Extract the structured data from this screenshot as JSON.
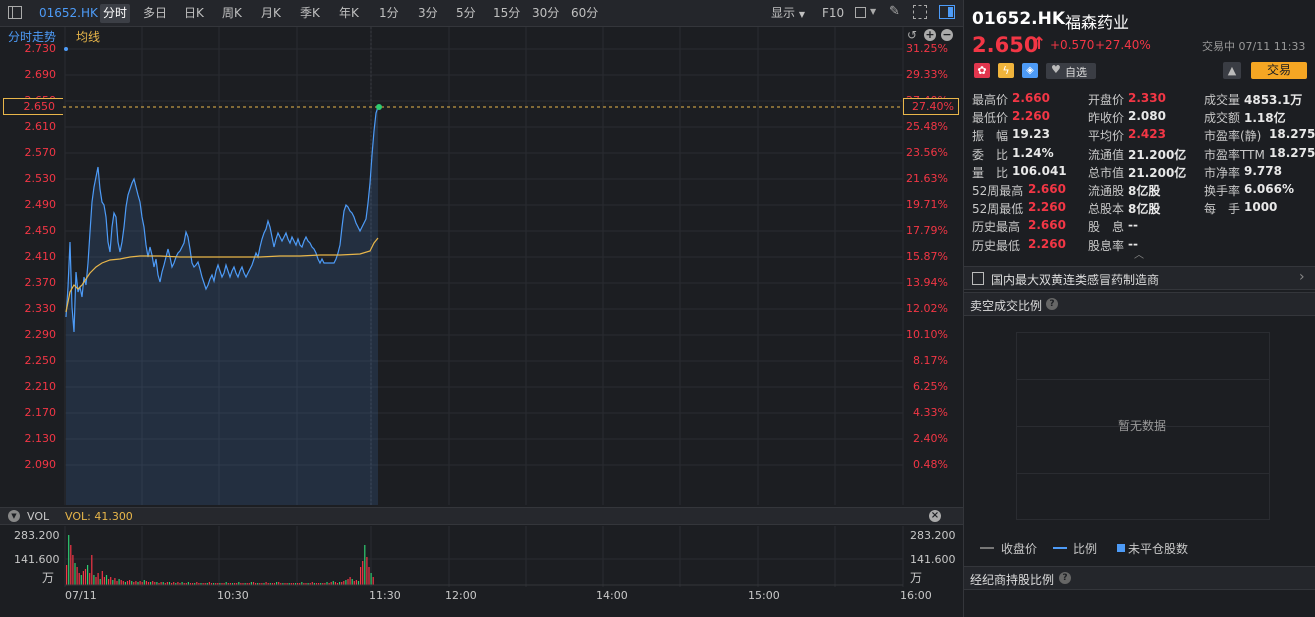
{
  "toolbar": {
    "code": "01652.HK",
    "periods": [
      "分时",
      "多日",
      "日K",
      "周K",
      "月K",
      "季K",
      "年K",
      "1分",
      "3分",
      "5分",
      "15分",
      "30分",
      "60分"
    ],
    "display_label": "显示",
    "f10_label": "F10"
  },
  "chart": {
    "title_label": "分时走势",
    "avg_label": "均线",
    "price_labels": [
      "2.730",
      "2.690",
      "2.650",
      "2.610",
      "2.570",
      "2.530",
      "2.490",
      "2.450",
      "2.410",
      "2.370",
      "2.330",
      "2.290",
      "2.250",
      "2.210",
      "2.170",
      "2.130",
      "2.090"
    ],
    "pct_labels": [
      "31.25%",
      "29.33%",
      "27.40%",
      "25.48%",
      "23.56%",
      "21.63%",
      "19.71%",
      "17.79%",
      "15.87%",
      "13.94%",
      "12.02%",
      "10.10%",
      "8.17%",
      "6.25%",
      "4.33%",
      "2.40%",
      "0.48%"
    ],
    "current_price_tag": "2.650",
    "current_pct_tag": "27.40%"
  },
  "volume": {
    "label": "VOL",
    "value_label": "VOL: 41.300",
    "y_top": "283.200",
    "y_mid": "141.600",
    "unit": "万",
    "time_labels": [
      "07/11",
      "10:30",
      "11:30",
      "12:00",
      "14:00",
      "15:00",
      "16:00"
    ]
  },
  "quote": {
    "code": "01652.HK",
    "name": "福森药业",
    "price": "2.650",
    "arrow": "↑",
    "change": "+0.570",
    "change_pct": "+27.40%",
    "status": "交易中 07/11 11:33",
    "watch_label": "自选",
    "trade_label": "交易"
  },
  "stats": [
    {
      "label": "最高价",
      "value": "2.660",
      "color": "red"
    },
    {
      "label": "开盘价",
      "value": "2.330",
      "color": "red"
    },
    {
      "label": "成交量",
      "value": "4853.1万",
      "color": "white"
    },
    {
      "label": "最低价",
      "value": "2.260",
      "color": "red"
    },
    {
      "label": "昨收价",
      "value": "2.080",
      "color": "white"
    },
    {
      "label": "成交额",
      "value": "1.18亿",
      "color": "white"
    },
    {
      "label": "振　幅",
      "value": "19.23",
      "color": "white"
    },
    {
      "label": "平均价",
      "value": "2.423",
      "color": "red"
    },
    {
      "label": "市盈率(静)",
      "value": "18.275",
      "color": "white"
    },
    {
      "label": "委　比",
      "value": "1.24%",
      "color": "white"
    },
    {
      "label": "流通值",
      "value": "21.200亿",
      "color": "white"
    },
    {
      "label": "市盈率TTM",
      "value": "18.275",
      "color": "white"
    },
    {
      "label": "量　比",
      "value": "106.041",
      "color": "white"
    },
    {
      "label": "总市值",
      "value": "21.200亿",
      "color": "white"
    },
    {
      "label": "市净率",
      "value": "9.778",
      "color": "white"
    },
    {
      "label": "52周最高",
      "value": "2.660",
      "color": "red"
    },
    {
      "label": "流通股",
      "value": "8亿股",
      "color": "white"
    },
    {
      "label": "换手率",
      "value": "6.066%",
      "color": "white"
    },
    {
      "label": "52周最低",
      "value": "2.260",
      "color": "red"
    },
    {
      "label": "总股本",
      "value": "8亿股",
      "color": "white"
    },
    {
      "label": "每　手",
      "value": "1000",
      "color": "white"
    },
    {
      "label": "历史最高",
      "value": "2.660",
      "color": "red"
    },
    {
      "label": "股　息",
      "value": "--",
      "color": "white"
    },
    {
      "label": "历史最低",
      "value": "2.260",
      "color": "red"
    },
    {
      "label": "股息率",
      "value": "--",
      "color": "white"
    }
  ],
  "company_desc": "国内最大双黄连类感冒药制造商",
  "short_ratio": {
    "title": "卖空成交比例",
    "empty_label": "暂无数据",
    "legend": [
      "收盘价",
      "比例",
      "未平仓股数"
    ]
  },
  "broker": {
    "title": "经纪商持股比例"
  },
  "colors": {
    "up": "#f23645",
    "price_line": "#4d9bf7",
    "avg_line": "#e8b64a",
    "trade_button": "#f5a623"
  }
}
